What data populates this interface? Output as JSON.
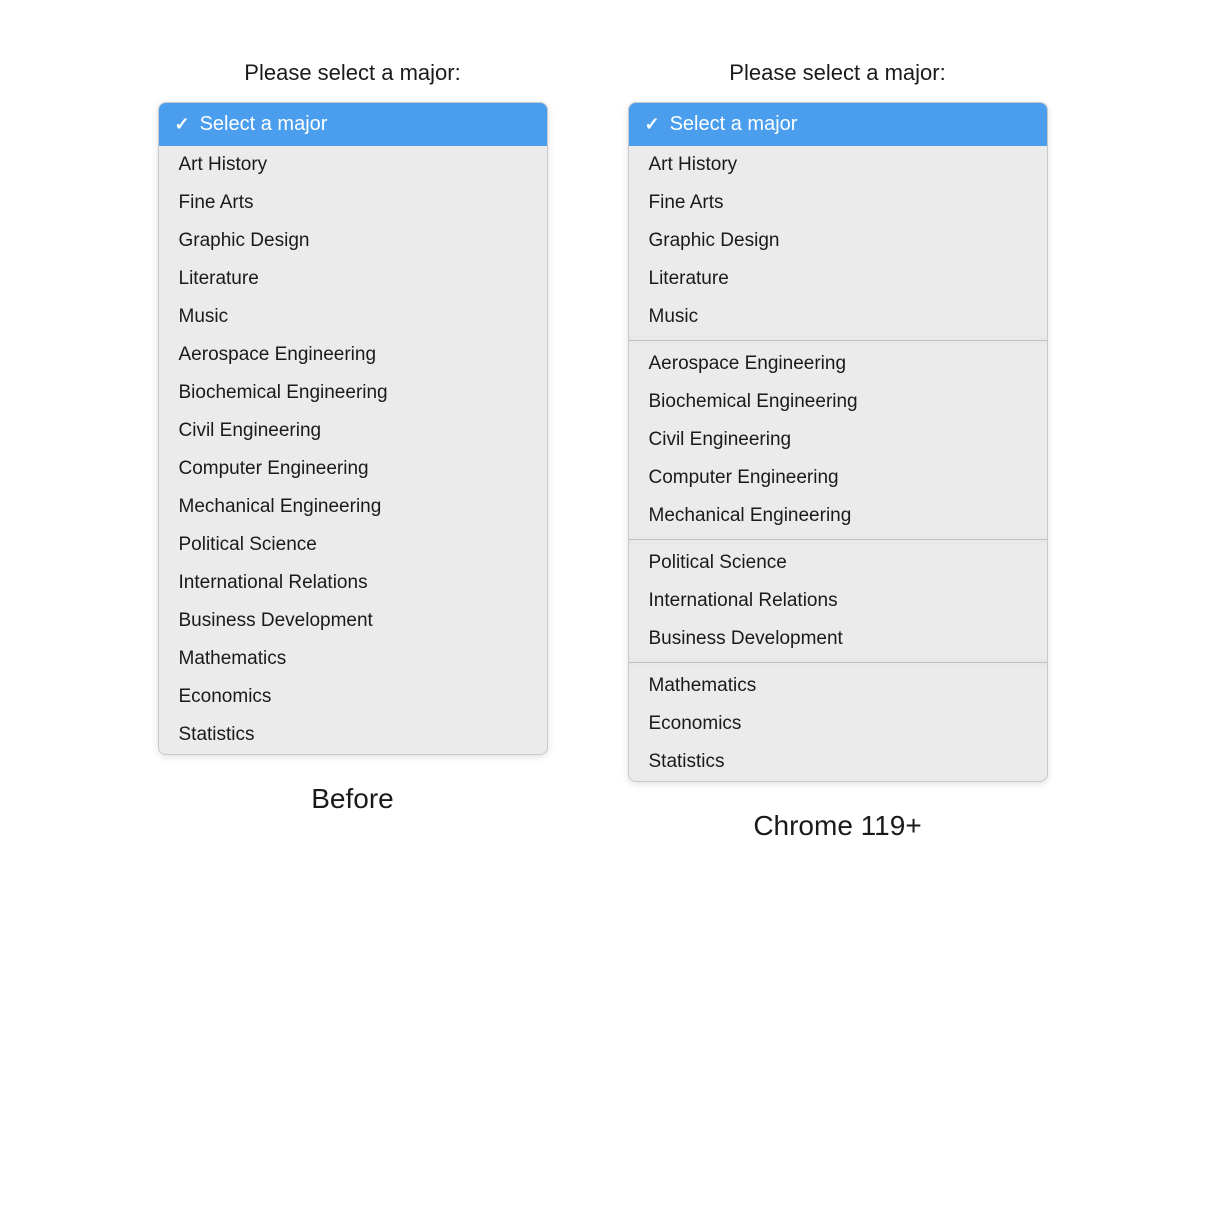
{
  "before": {
    "label": "Before",
    "select_label": "Please select a major:",
    "selected": "Select a major",
    "options": [
      "Art History",
      "Fine Arts",
      "Graphic Design",
      "Literature",
      "Music",
      "Aerospace Engineering",
      "Biochemical Engineering",
      "Civil Engineering",
      "Computer Engineering",
      "Mechanical Engineering",
      "Political Science",
      "International Relations",
      "Business Development",
      "Mathematics",
      "Economics",
      "Statistics"
    ]
  },
  "after": {
    "label": "Chrome 119+",
    "select_label": "Please select a major:",
    "selected": "Select a major",
    "groups": [
      {
        "items": [
          "Art History",
          "Fine Arts",
          "Graphic Design",
          "Literature",
          "Music"
        ]
      },
      {
        "items": [
          "Aerospace Engineering",
          "Biochemical Engineering",
          "Civil Engineering",
          "Computer Engineering",
          "Mechanical Engineering"
        ]
      },
      {
        "items": [
          "Political Science",
          "International Relations",
          "Business Development"
        ]
      },
      {
        "items": [
          "Mathematics",
          "Economics",
          "Statistics"
        ]
      }
    ]
  }
}
